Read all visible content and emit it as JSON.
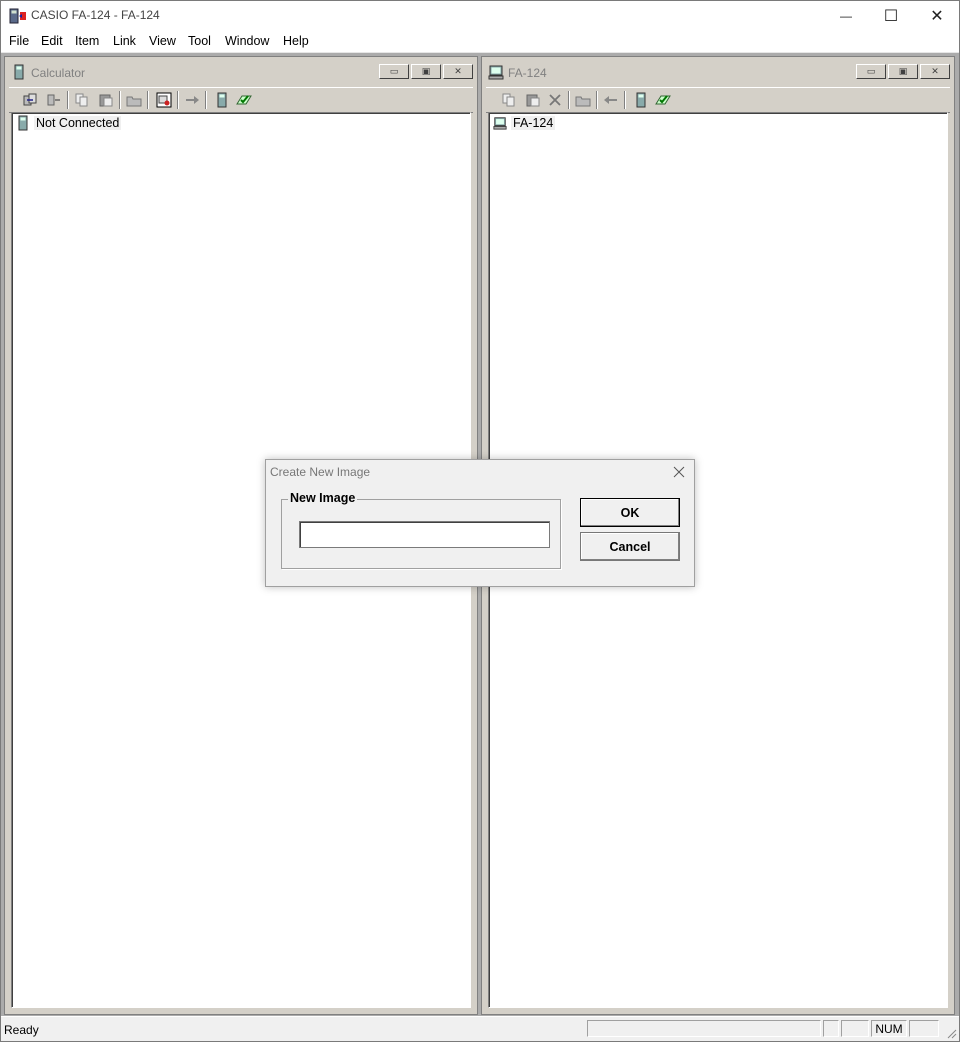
{
  "window": {
    "title": "CASIO FA-124 - FA-124",
    "controls": {
      "minimize": "—",
      "maximize": "☐",
      "close": "✕"
    }
  },
  "menubar": {
    "items": [
      "File",
      "Edit",
      "Item",
      "Link",
      "View",
      "Tool",
      "Window",
      "Help"
    ]
  },
  "panels": {
    "calculator": {
      "title": "Calculator",
      "tree_item": "Not Connected"
    },
    "pc": {
      "title": "FA-124",
      "tree_item": "FA-124"
    }
  },
  "dialog": {
    "title": "Create New Image",
    "group_label": "New Image",
    "input_value": "",
    "ok_label": "OK",
    "cancel_label": "Cancel"
  },
  "statusbar": {
    "text": "Ready",
    "num_indicator": "NUM"
  },
  "colors": {
    "mdi_background": "#ababab",
    "dialog_face": "#f0f0f0",
    "child_face": "#d4d0c8"
  }
}
